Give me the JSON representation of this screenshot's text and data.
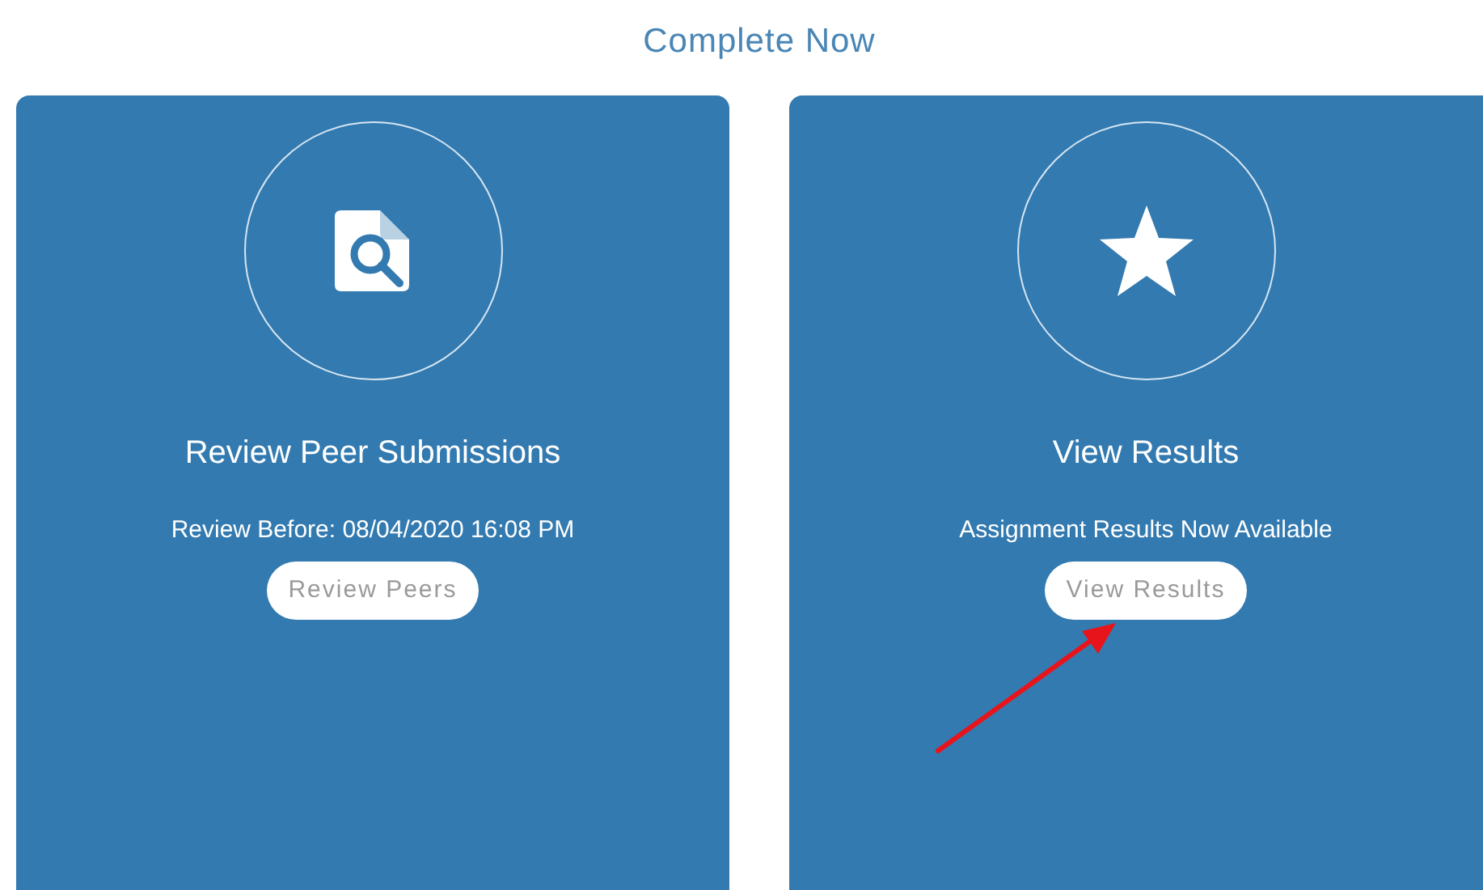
{
  "heading": "Complete Now",
  "cards": [
    {
      "kind": "review",
      "title": "Review Peer Submissions",
      "subtitle": "Review Before: 08/04/2020 16:08 PM",
      "button": "Review Peers"
    },
    {
      "kind": "results",
      "title": "View Results",
      "subtitle": "Assignment Results Now Available",
      "button": "View Results"
    }
  ]
}
